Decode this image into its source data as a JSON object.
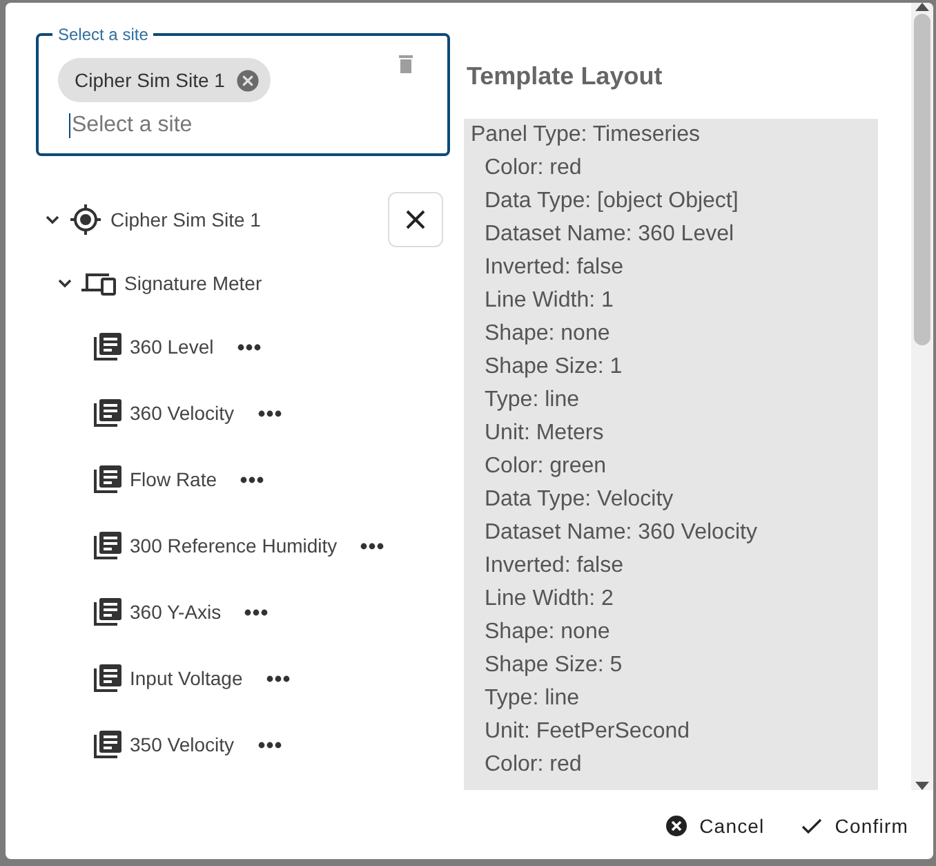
{
  "site_select": {
    "label": "Select a site",
    "chips": [
      {
        "label": "Cipher Sim Site 1"
      }
    ],
    "placeholder": "Select a site"
  },
  "tree": {
    "label": "Cipher Sim Site 1",
    "expanded": true,
    "children": [
      {
        "label": "Signature Meter",
        "expanded": true,
        "children": [
          {
            "label": "360 Level"
          },
          {
            "label": "360 Velocity"
          },
          {
            "label": "Flow Rate"
          },
          {
            "label": "300 Reference Humidity"
          },
          {
            "label": "360 Y-Axis"
          },
          {
            "label": "Input Voltage"
          },
          {
            "label": "350 Velocity"
          }
        ]
      }
    ]
  },
  "template_layout": {
    "title": "Template Layout",
    "lines": [
      {
        "kind": "header",
        "text": "Panel Type: Timeseries"
      },
      {
        "kind": "property",
        "text": "Color: red"
      },
      {
        "kind": "property",
        "text": "Data Type: [object Object]"
      },
      {
        "kind": "property",
        "text": "Dataset Name: 360 Level"
      },
      {
        "kind": "property",
        "text": "Inverted: false"
      },
      {
        "kind": "property",
        "text": "Line Width: 1"
      },
      {
        "kind": "property",
        "text": "Shape: none"
      },
      {
        "kind": "property",
        "text": "Shape Size: 1"
      },
      {
        "kind": "property",
        "text": "Type: line"
      },
      {
        "kind": "property",
        "text": "Unit: Meters"
      },
      {
        "kind": "property",
        "text": "Color: green"
      },
      {
        "kind": "property",
        "text": "Data Type: Velocity"
      },
      {
        "kind": "property",
        "text": "Dataset Name: 360 Velocity"
      },
      {
        "kind": "property",
        "text": "Inverted: false"
      },
      {
        "kind": "property",
        "text": "Line Width: 2"
      },
      {
        "kind": "property",
        "text": "Shape: none"
      },
      {
        "kind": "property",
        "text": "Shape Size: 5"
      },
      {
        "kind": "property",
        "text": "Type: line"
      },
      {
        "kind": "property",
        "text": "Unit: FeetPerSecond"
      },
      {
        "kind": "property",
        "text": "Color: red"
      }
    ]
  },
  "buttons": [
    {
      "kind": "cancel",
      "label": "Cancel"
    },
    {
      "kind": "confirm",
      "label": "Confirm"
    }
  ]
}
